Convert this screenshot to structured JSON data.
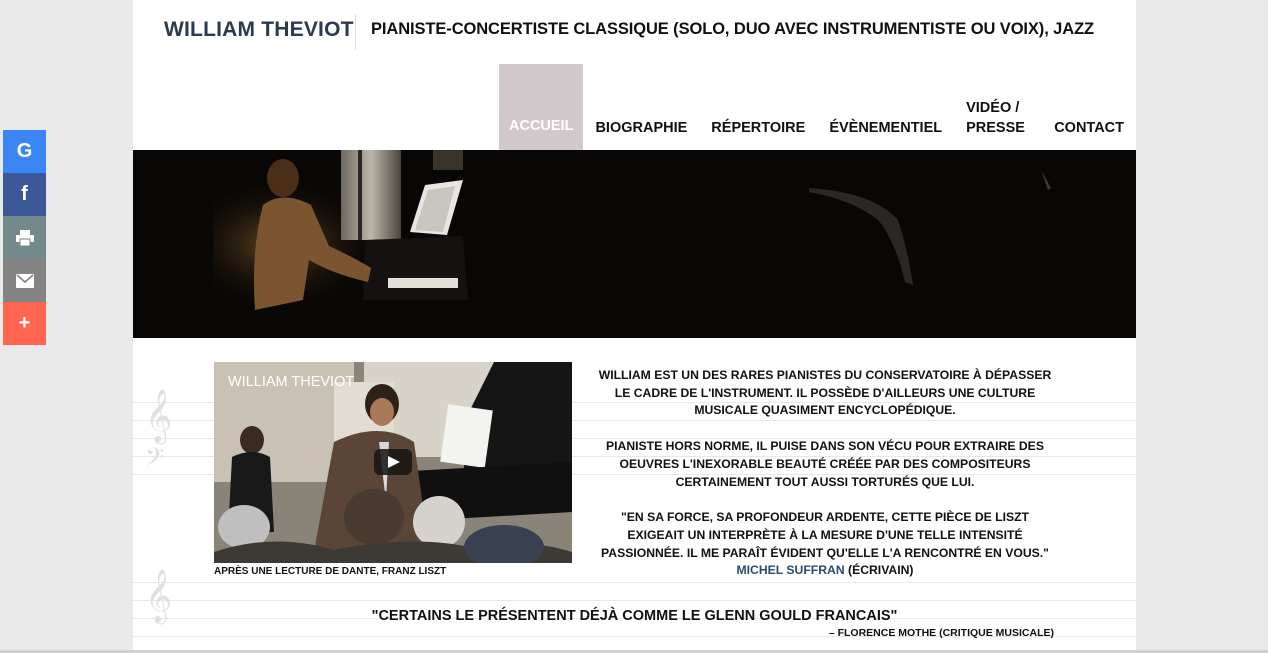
{
  "header": {
    "brand": "WILLIAM THEVIOT",
    "tagline": "PIANISTE-CONCERTISTE CLASSIQUE (SOLO, DUO AVEC INSTRUMENTISTE OU VOIX), JAZZ"
  },
  "nav": {
    "items": [
      {
        "label": "ACCUEIL"
      },
      {
        "label": "BIOGRAPHIE"
      },
      {
        "label": "RÉPERTOIRE"
      },
      {
        "label": "ÉVÈNEMENTIEL"
      },
      {
        "label": "VIDÉO / PRESSE"
      },
      {
        "label": "CONTACT"
      }
    ],
    "active_color": "#d2c9cd"
  },
  "video": {
    "title": "WILLIAM THEVIOT",
    "caption": "APRÈS UNE LECTURE DE DANTE, FRANZ LISZT"
  },
  "intro": {
    "p1": "WILLIAM EST UN DES RARES PIANISTES DU CONSERVATOIRE À DÉPASSER LE CADRE DE L'INSTRUMENT. IL POSSÈDE D'AILLEURS UNE CULTURE MUSICALE QUASIMENT ENCYCLOPÉDIQUE.",
    "p2": "PIANISTE HORS NORME, IL PUISE DANS SON VÉCU POUR EXTRAIRE DES OEUVRES L'INEXORABLE BEAUTÉ CRÉÉE PAR DES COMPOSITEURS CERTAINEMENT TOUT AUSSI TORTURÉS QUE LUI.",
    "p3": "\"EN SA FORCE, SA PROFONDEUR ARDENTE, CETTE PIÈCE DE LISZT EXIGEAIT UN INTERPRÈTE À LA MESURE D'UNE TELLE INTENSITÉ PASSIONNÉE. IL ME PARAÎT ÉVIDENT QU'ELLE L'A RENCONTRÉ EN VOUS.\"",
    "p3_author": "MICHEL SUFFRAN",
    "p3_role": "(ÉCRIVAIN)"
  },
  "quote": {
    "text": "\"CERTAINS LE PRÉSENTENT DÉJÀ COMME LE GLENN GOULD FRANCAIS\"",
    "author": "– FLORENCE MOTHE (CRITIQUE MUSICALE)"
  },
  "share": {
    "buttons": [
      {
        "icon": "google-icon",
        "glyph": "G",
        "color": "#3b86f5"
      },
      {
        "icon": "facebook-icon",
        "glyph": "f",
        "color": "#3b5998"
      },
      {
        "icon": "print-icon",
        "glyph": "",
        "color": "#738a8d"
      },
      {
        "icon": "email-icon",
        "glyph": "",
        "color": "#848484"
      },
      {
        "icon": "plus-icon",
        "glyph": "+",
        "color": "#ff6550"
      }
    ]
  }
}
